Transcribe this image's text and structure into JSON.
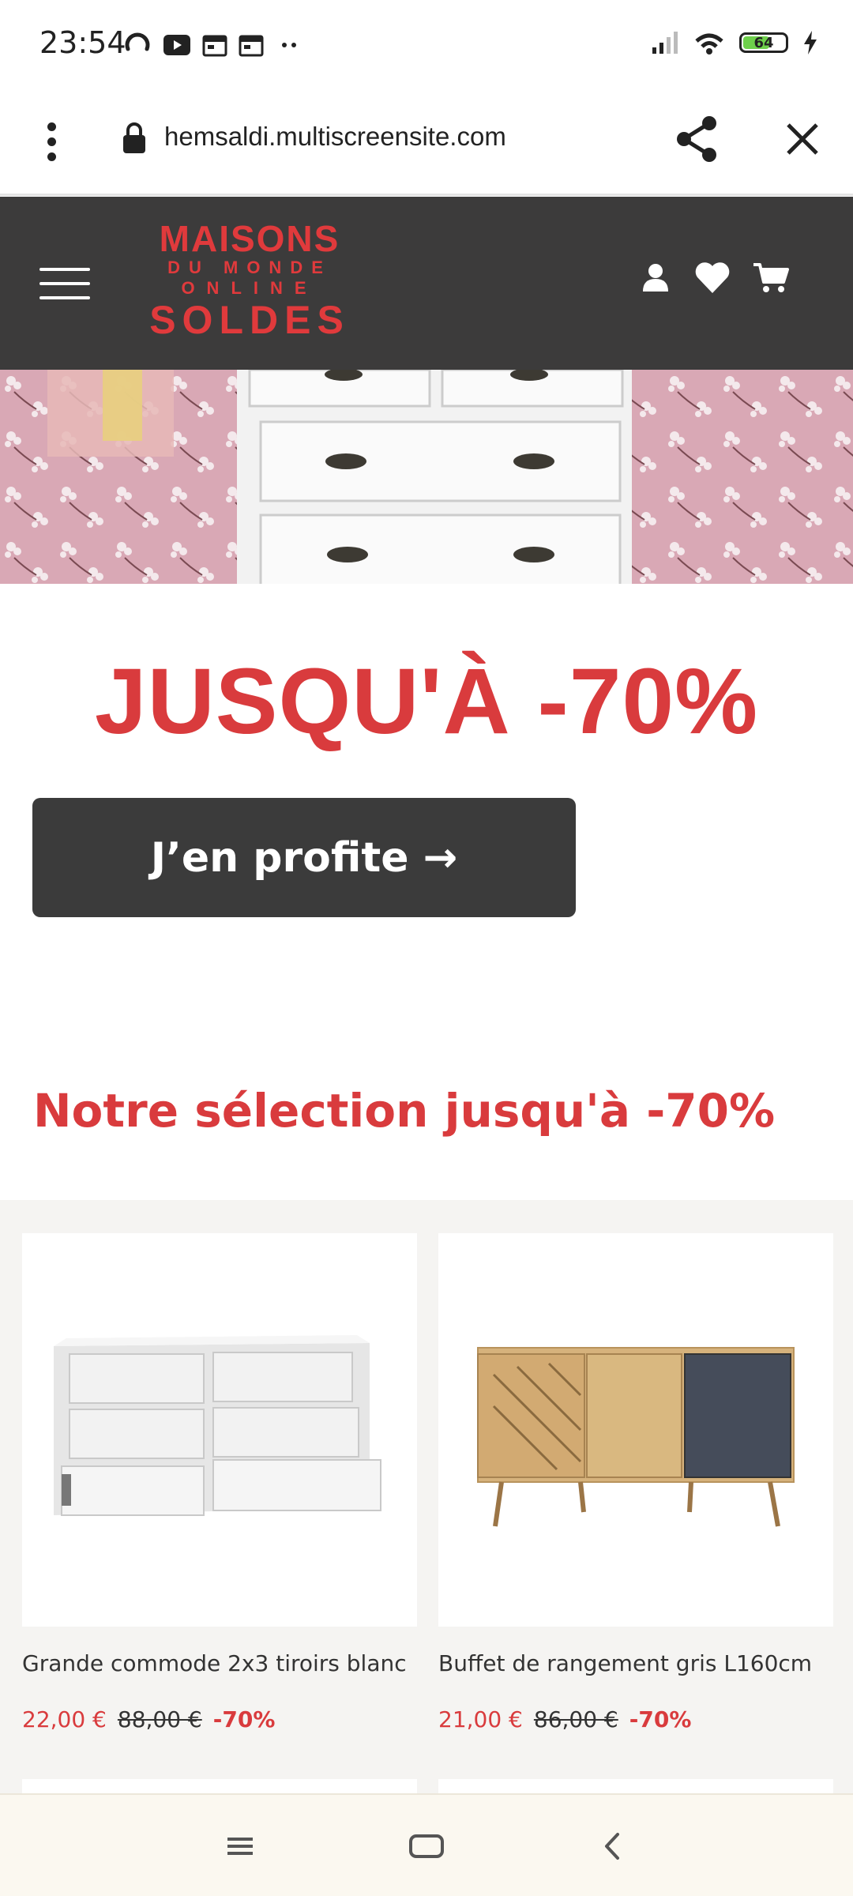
{
  "status_bar": {
    "time": "23:54",
    "battery_level": "64",
    "battery_fraction": 0.64,
    "icons_left": [
      "sync-icon",
      "youtube-icon",
      "calendar-icon",
      "calendar-icon",
      "more-dots-icon"
    ],
    "icons_right": [
      "signal-icon",
      "wifi-icon",
      "battery-icon",
      "charging-icon"
    ]
  },
  "browser": {
    "url": "hemsaldi.multiscreensite.com"
  },
  "header": {
    "logo": {
      "line1": "MAISONS",
      "line2": "DU MONDE",
      "line3": "ONLINE",
      "line4": "SOLDES"
    },
    "icons": [
      "user-icon",
      "heart-icon",
      "cart-icon"
    ]
  },
  "hero": {
    "headline": "JUSQU'À -70%",
    "cta_label": "J’en profite →"
  },
  "selection": {
    "title": "Notre sélection jusqu'à -70%",
    "products": [
      {
        "name": "Grande commode 2x3 tiroirs blanc",
        "price": "22,00 €",
        "old_price": "88,00 €",
        "discount": "-70%"
      },
      {
        "name": "Buffet de rangement gris L160cm",
        "price": "21,00 €",
        "old_price": "86,00 €",
        "discount": "-70%"
      }
    ]
  },
  "colors": {
    "brand_red": "#d93b3d",
    "header_bg": "#3c3b3b",
    "button_bg": "#3b3b3b",
    "grid_bg": "#f5f4f2"
  }
}
